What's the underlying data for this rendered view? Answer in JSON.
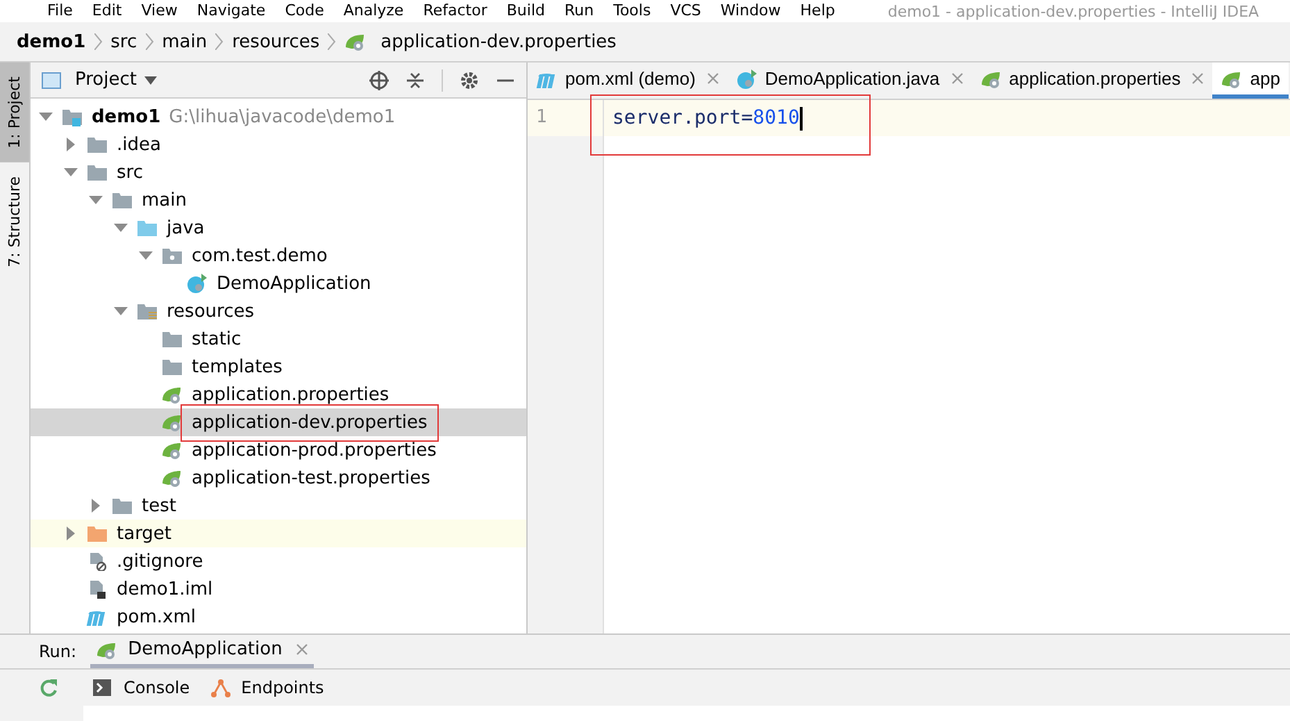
{
  "menu": [
    "File",
    "Edit",
    "View",
    "Navigate",
    "Code",
    "Analyze",
    "Refactor",
    "Build",
    "Run",
    "Tools",
    "VCS",
    "Window",
    "Help"
  ],
  "window": {
    "title": "demo1 - application-dev.properties - IntelliJ IDEA"
  },
  "breadcrumbs": [
    {
      "label": "demo1",
      "kind": "project"
    },
    {
      "label": "src",
      "kind": "folder"
    },
    {
      "label": "main",
      "kind": "folder"
    },
    {
      "label": "resources",
      "kind": "folder"
    },
    {
      "label": "application-dev.properties",
      "kind": "spring"
    }
  ],
  "side_tabs": [
    {
      "label": "1: Project",
      "selected": true
    },
    {
      "label": "7: Structure",
      "selected": false
    }
  ],
  "project_panel": {
    "title": "Project",
    "tree": [
      {
        "label": "demo1",
        "path": "G:\\lihua\\javacode\\demo1",
        "kind": "module",
        "expanded": true,
        "selected": false,
        "highlighted": false,
        "children": [
          {
            "label": ".idea",
            "kind": "folder",
            "expanded": false,
            "selected": false,
            "highlighted": false
          },
          {
            "label": "src",
            "kind": "folder",
            "expanded": true,
            "selected": false,
            "highlighted": false,
            "children": [
              {
                "label": "main",
                "kind": "folder",
                "expanded": true,
                "selected": false,
                "highlighted": false,
                "children": [
                  {
                    "label": "java",
                    "kind": "source",
                    "expanded": true,
                    "selected": false,
                    "highlighted": false,
                    "children": [
                      {
                        "label": "com.test.demo",
                        "kind": "package",
                        "expanded": true,
                        "selected": false,
                        "highlighted": false,
                        "children": [
                          {
                            "label": "DemoApplication",
                            "kind": "class",
                            "selected": false,
                            "highlighted": false
                          }
                        ]
                      }
                    ]
                  },
                  {
                    "label": "resources",
                    "kind": "resources",
                    "expanded": true,
                    "selected": false,
                    "highlighted": false,
                    "children": [
                      {
                        "label": "static",
                        "kind": "folder",
                        "selected": false,
                        "highlighted": false
                      },
                      {
                        "label": "templates",
                        "kind": "folder",
                        "selected": false,
                        "highlighted": false
                      },
                      {
                        "label": "application.properties",
                        "kind": "spring",
                        "selected": false,
                        "highlighted": false
                      },
                      {
                        "label": "application-dev.properties",
                        "kind": "spring",
                        "selected": true,
                        "highlighted": true
                      },
                      {
                        "label": "application-prod.properties",
                        "kind": "spring",
                        "selected": false,
                        "highlighted": false
                      },
                      {
                        "label": "application-test.properties",
                        "kind": "spring",
                        "selected": false,
                        "highlighted": false
                      }
                    ]
                  }
                ]
              },
              {
                "label": "test",
                "kind": "folder",
                "expanded": false,
                "selected": false,
                "highlighted": false
              }
            ]
          },
          {
            "label": "target",
            "kind": "excluded",
            "expanded": false,
            "selected": false,
            "highlighted": false
          },
          {
            "label": ".gitignore",
            "kind": "ignore",
            "selected": false,
            "highlighted": false
          },
          {
            "label": "demo1.iml",
            "kind": "iml",
            "selected": false,
            "highlighted": false
          },
          {
            "label": "pom.xml",
            "kind": "maven",
            "selected": false,
            "highlighted": false
          }
        ]
      }
    ]
  },
  "editor_tabs": [
    {
      "label": "pom.xml (demo)",
      "kind": "maven",
      "selected": false,
      "closable": true
    },
    {
      "label": "DemoApplication.java",
      "kind": "class",
      "selected": false,
      "closable": true
    },
    {
      "label": "application.properties",
      "kind": "spring",
      "selected": false,
      "closable": true
    },
    {
      "label": "app",
      "kind": "spring",
      "selected": true,
      "closable": false
    }
  ],
  "editor": {
    "highlighted": true,
    "lines": [
      {
        "number": "1",
        "key": "server.port=",
        "value": "8010",
        "current": true
      }
    ]
  },
  "run_panel": {
    "label": "Run:",
    "tabs": [
      {
        "label": "DemoApplication",
        "selected": true
      }
    ],
    "tool_tabs": [
      {
        "label": "Console",
        "kind": "console"
      },
      {
        "label": "Endpoints",
        "kind": "endpoints"
      }
    ]
  }
}
